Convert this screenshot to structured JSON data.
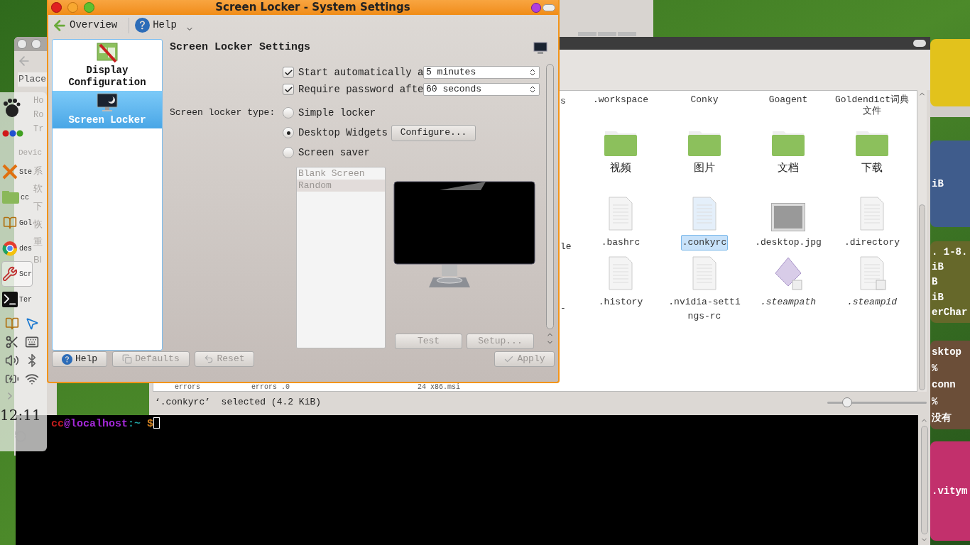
{
  "conky": [
    {
      "color": "#e2c21c"
    },
    {
      "color": "#3f5c8c",
      "lines": [
        "iB"
      ]
    },
    {
      "color": "#66682a",
      "lines": [
        ". 1-8.",
        "iB",
        "B",
        "iB",
        "erChar"
      ]
    },
    {
      "color": "#6b4e38",
      "lines": [
        "sktop",
        "%",
        "conn",
        "%",
        "没有"
      ]
    },
    {
      "color": "#c2306c",
      "lines": [
        ".vitym"
      ]
    }
  ],
  "back_window": {
    "tab": "Place",
    "items": [
      "Ho",
      "Ro",
      "Tr"
    ],
    "section": "Devic",
    "entries": [
      "系",
      "软",
      "下",
      "恢",
      "重",
      "Bl"
    ]
  },
  "panel": {
    "launchers": [
      {
        "selected": false
      },
      {
        "selected": false
      },
      {
        "label": "Ste",
        "selected": false
      },
      {
        "label": "cc",
        "selected": false
      },
      {
        "label": "Gol",
        "selected": false
      },
      {
        "label": "des",
        "selected": false
      },
      {
        "label": "Scr",
        "selected": true
      },
      {
        "label": "Ter",
        "selected": false
      }
    ],
    "clock": "12:11"
  },
  "file_manager": {
    "edge_labels": [
      "s",
      "le",
      "-"
    ],
    "top_labels": [
      ".workspace",
      "Conky",
      "Goagent",
      "Goldendict词典文件"
    ],
    "folders": [
      "视频",
      "图片",
      "文档",
      "下载"
    ],
    "files": [
      {
        "name": ".bashrc",
        "kind": "text",
        "selected": false,
        "italic": false
      },
      {
        "name": ".conkyrc",
        "kind": "text",
        "selected": true,
        "italic": false
      },
      {
        "name": ".desktop.jpg",
        "kind": "image",
        "selected": false,
        "italic": false
      },
      {
        "name": ".directory",
        "kind": "text",
        "selected": false,
        "italic": false
      },
      {
        "name": ".history",
        "kind": "text",
        "selected": false,
        "italic": false
      },
      {
        "name": ".nvidia-settings-rc",
        "kind": "text",
        "selected": false,
        "italic": false
      },
      {
        "name": ".steampath",
        "kind": "link",
        "selected": false,
        "italic": true
      },
      {
        "name": ".steampid",
        "kind": "linkdoc",
        "selected": false,
        "italic": true
      }
    ],
    "partial_row": [
      "errors",
      "errors .0",
      "24 x86.msi"
    ],
    "status": "‘.conkyrc’  selected (4.2 KiB)",
    "zoom": {
      "level": 0.2
    }
  },
  "terminal": {
    "prompt": [
      {
        "text": "cc",
        "color": "#c01c1c"
      },
      {
        "text": "@localhost",
        "color": "#a428d8"
      },
      {
        "text": ":~",
        "color": "#20a0a0"
      },
      {
        "text": " $",
        "color": "#d08020"
      }
    ]
  },
  "dialog": {
    "title": "Screen Locker - System Settings",
    "toolbar": [
      {
        "label": "Overview"
      },
      {
        "label": "Help"
      }
    ],
    "modules": [
      {
        "label": "Display Configuration",
        "selected": false
      },
      {
        "label": "Screen Locker",
        "selected": true
      }
    ],
    "heading": "Screen Locker Settings",
    "options": [
      {
        "label": "Start automatically a",
        "checked": true,
        "value": "5 minutes"
      },
      {
        "label": "Require password afte",
        "checked": true,
        "value": "60 seconds"
      }
    ],
    "type_label": "Screen locker type:",
    "types": [
      {
        "label": "Simple locker",
        "selected": false
      },
      {
        "label": "Desktop Widgets",
        "selected": true,
        "button": "Configure..."
      },
      {
        "label": "Screen saver",
        "selected": false
      }
    ],
    "savers": {
      "disabled": true,
      "items": [
        {
          "label": "Blank Screen",
          "selected": false
        },
        {
          "label": "Random",
          "selected": true
        }
      ]
    },
    "preview_buttons": [
      {
        "label": "Test",
        "disabled": true
      },
      {
        "label": "Setup...",
        "disabled": true
      }
    ],
    "footer": [
      {
        "label": "Help",
        "disabled": false
      },
      {
        "label": "Defaults",
        "disabled": true
      },
      {
        "label": "Reset",
        "disabled": true
      }
    ],
    "apply": {
      "label": "Apply",
      "disabled": true
    }
  }
}
